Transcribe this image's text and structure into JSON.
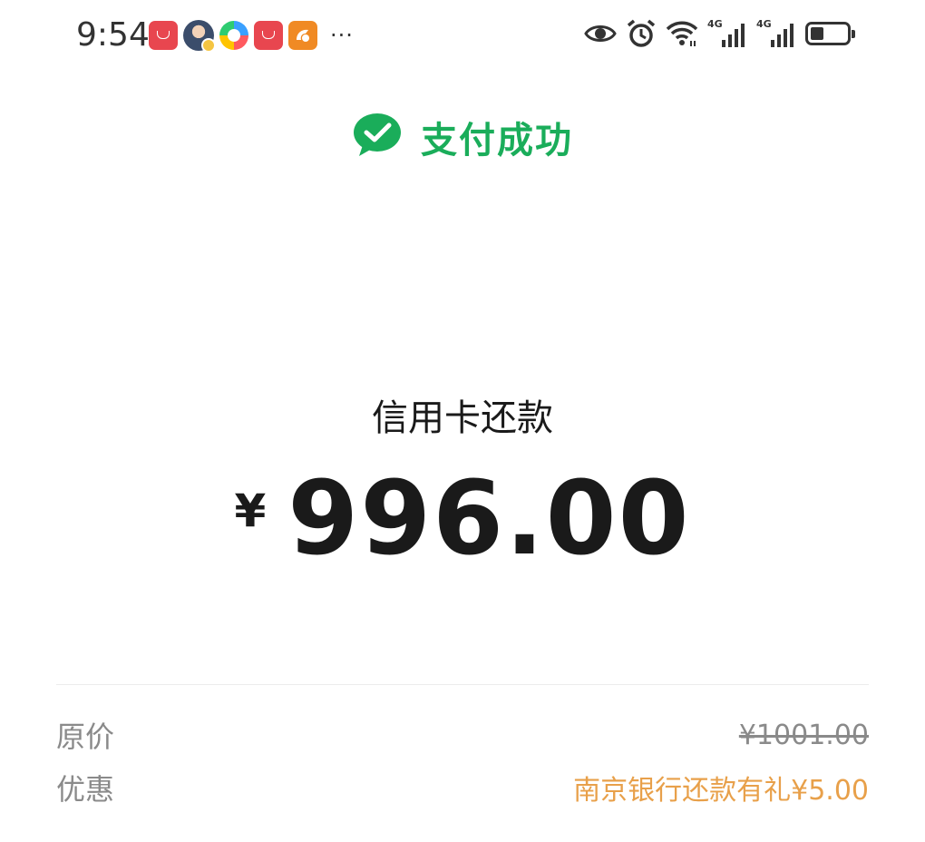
{
  "status_bar": {
    "time": "9:54",
    "network_label_1": "4G",
    "network_label_2": "4G",
    "battery_level": 0.45,
    "notification_icons": [
      "huawei-appgallery-icon",
      "avatar-icon",
      "swirl-app-icon",
      "huawei-appgallery-icon",
      "orange-app-icon"
    ],
    "more_indicator": "···",
    "system_icons": [
      "eye-icon",
      "alarm-icon",
      "wifi-icon",
      "signal-icon",
      "signal-icon",
      "battery-icon"
    ]
  },
  "header": {
    "status_text": "支付成功",
    "icon": "wechat-pay-icon",
    "accent_color": "#1aad5a"
  },
  "payment": {
    "merchant": "信用卡还款",
    "currency_symbol": "¥",
    "amount": "996.00"
  },
  "details": {
    "original_label": "原价",
    "original_value": "¥1001.00",
    "discount_label": "优惠",
    "discount_value": "南京银行还款有礼¥5.00",
    "discount_color": "#e8a04a"
  }
}
